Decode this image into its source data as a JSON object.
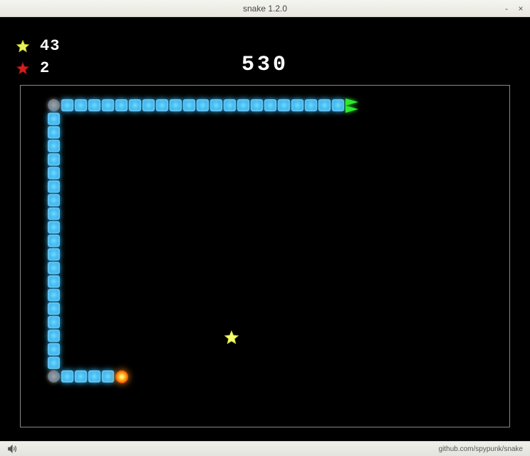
{
  "window": {
    "title": "snake 1.2.0",
    "minimize": "-",
    "close": "×"
  },
  "hud": {
    "yellow_star_count": "43",
    "red_star_count": "2"
  },
  "score": "530",
  "status": {
    "repo_text": "github.com/spypunk/snake"
  },
  "game": {
    "cell_size_px": 19,
    "head": {
      "col": 24,
      "row": 1,
      "dir": "right"
    },
    "food": {
      "col": 7,
      "row": 21
    },
    "star": {
      "col": 15,
      "row": 18
    },
    "segments": [
      {
        "col": 23,
        "row": 1
      },
      {
        "col": 22,
        "row": 1
      },
      {
        "col": 21,
        "row": 1
      },
      {
        "col": 20,
        "row": 1
      },
      {
        "col": 19,
        "row": 1
      },
      {
        "col": 18,
        "row": 1
      },
      {
        "col": 17,
        "row": 1
      },
      {
        "col": 16,
        "row": 1
      },
      {
        "col": 15,
        "row": 1
      },
      {
        "col": 14,
        "row": 1
      },
      {
        "col": 13,
        "row": 1
      },
      {
        "col": 12,
        "row": 1
      },
      {
        "col": 11,
        "row": 1
      },
      {
        "col": 10,
        "row": 1
      },
      {
        "col": 9,
        "row": 1
      },
      {
        "col": 8,
        "row": 1
      },
      {
        "col": 7,
        "row": 1
      },
      {
        "col": 6,
        "row": 1
      },
      {
        "col": 5,
        "row": 1
      },
      {
        "col": 4,
        "row": 1
      },
      {
        "col": 3,
        "row": 1
      },
      {
        "col": 2,
        "row": 1,
        "corner": true
      },
      {
        "col": 2,
        "row": 2
      },
      {
        "col": 2,
        "row": 3
      },
      {
        "col": 2,
        "row": 4
      },
      {
        "col": 2,
        "row": 5
      },
      {
        "col": 2,
        "row": 6
      },
      {
        "col": 2,
        "row": 7
      },
      {
        "col": 2,
        "row": 8
      },
      {
        "col": 2,
        "row": 9
      },
      {
        "col": 2,
        "row": 10
      },
      {
        "col": 2,
        "row": 11
      },
      {
        "col": 2,
        "row": 12
      },
      {
        "col": 2,
        "row": 13
      },
      {
        "col": 2,
        "row": 14
      },
      {
        "col": 2,
        "row": 15
      },
      {
        "col": 2,
        "row": 16
      },
      {
        "col": 2,
        "row": 17
      },
      {
        "col": 2,
        "row": 18
      },
      {
        "col": 2,
        "row": 19
      },
      {
        "col": 2,
        "row": 20
      },
      {
        "col": 2,
        "row": 21,
        "corner": true
      },
      {
        "col": 3,
        "row": 21
      },
      {
        "col": 4,
        "row": 21
      },
      {
        "col": 5,
        "row": 21
      },
      {
        "col": 6,
        "row": 21
      }
    ]
  }
}
